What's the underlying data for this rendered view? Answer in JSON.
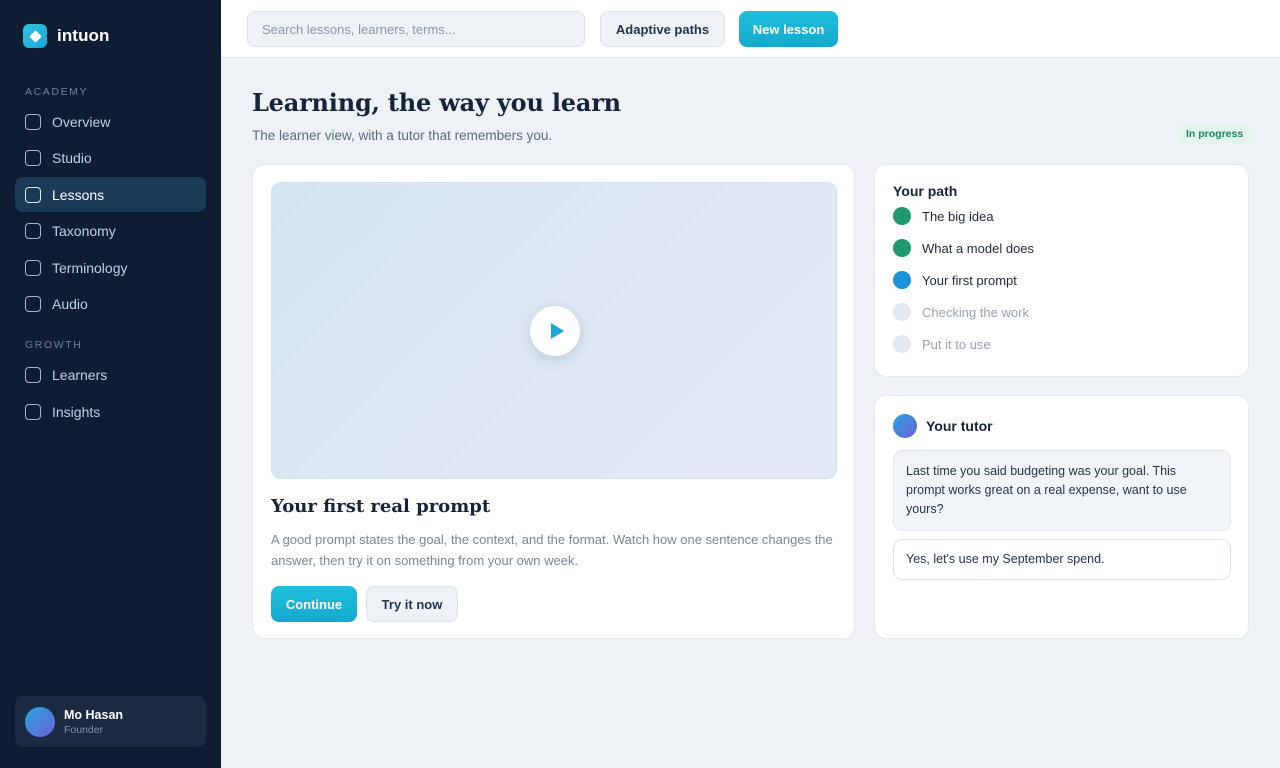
{
  "brand": {
    "name": "intuon"
  },
  "sidebar": {
    "sections": [
      {
        "label": "ACADEMY",
        "items": [
          "Overview",
          "Studio",
          "Lessons",
          "Taxonomy",
          "Terminology",
          "Audio"
        ]
      },
      {
        "label": "GROWTH",
        "items": [
          "Learners",
          "Insights"
        ]
      }
    ],
    "active_item": "Lessons",
    "user": {
      "name": "Mo Hasan",
      "role": "Founder"
    }
  },
  "topbar": {
    "search_placeholder": "Search lessons, learners, terms...",
    "adaptive_label": "Adaptive paths",
    "new_lesson_label": "New lesson"
  },
  "header": {
    "title": "Learning, the way you learn",
    "subtitle": "The learner view, with a tutor that remembers you.",
    "status": "In progress"
  },
  "lesson": {
    "title": "Your first real prompt",
    "body": "A good prompt states the goal, the context, and the format. Watch how one sentence changes the answer, then try it on something from your own week.",
    "continue_label": "Continue",
    "try_label": "Try it now"
  },
  "path": {
    "heading": "Your path",
    "steps": [
      {
        "label": "The big idea",
        "state": "done"
      },
      {
        "label": "What a model does",
        "state": "done"
      },
      {
        "label": "Your first prompt",
        "state": "current"
      },
      {
        "label": "Checking the work",
        "state": "todo"
      },
      {
        "label": "Put it to use",
        "state": "todo"
      }
    ]
  },
  "tutor": {
    "heading": "Your tutor",
    "message": "Last time you said budgeting was your goal. This prompt works great on a real expense, want to use yours?",
    "reply": "Yes, let's use my September spend."
  },
  "colors": {
    "accent": "#1ec0dc",
    "sidebar_bg": "#0f1d33",
    "done": "#1f9a6c",
    "current": "#1b92d6",
    "todo": "#e4e9f1"
  }
}
